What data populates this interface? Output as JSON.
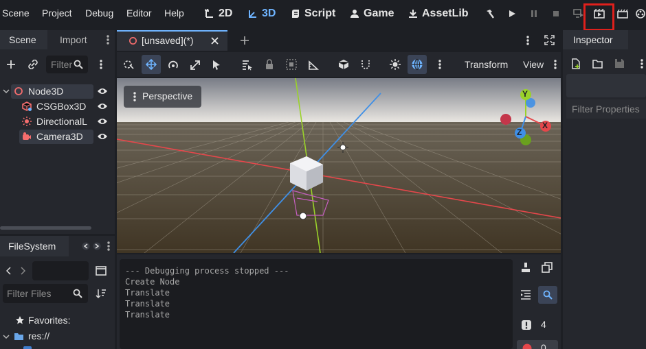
{
  "menu": {
    "items": [
      "Scene",
      "Project",
      "Debug",
      "Editor",
      "Help"
    ],
    "workspaces": [
      {
        "label": "2D",
        "icon": "2d-workspace-icon",
        "active": false
      },
      {
        "label": "3D",
        "icon": "3d-workspace-icon",
        "active": true
      },
      {
        "label": "Script",
        "icon": "script-icon",
        "active": false
      },
      {
        "label": "Game",
        "icon": "game-icon",
        "active": false
      },
      {
        "label": "AssetLib",
        "icon": "assetlib-icon",
        "active": false
      }
    ]
  },
  "scene_dock": {
    "tabs": [
      "Scene",
      "Import"
    ],
    "filter_placeholder": "Filter",
    "nodes": [
      {
        "label": "Node3D",
        "icon": "node3d-icon"
      },
      {
        "label": "CSGBox3D",
        "icon": "csgbox-icon"
      },
      {
        "label": "DirectionalL",
        "icon": "directional-light-icon"
      },
      {
        "label": "Camera3D",
        "icon": "camera-icon"
      }
    ]
  },
  "filesystem_dock": {
    "title": "FileSystem",
    "filter_placeholder": "Filter Files",
    "favorites_label": "Favorites:",
    "root_label": "res://"
  },
  "editor": {
    "tab_label": "[unsaved](*)",
    "transform_menu": "Transform",
    "view_menu": "View",
    "perspective_label": "Perspective",
    "gizmo_axes": {
      "x": "X",
      "y": "Y",
      "z": "Z"
    }
  },
  "output": {
    "lines": [
      "--- Debugging process stopped ---",
      "Create Node",
      "Translate",
      "Translate",
      "Translate"
    ],
    "warning_count": "4",
    "error_count": "0"
  },
  "inspector": {
    "title": "Inspector",
    "filter_placeholder": "Filter Properties"
  },
  "colors": {
    "accent": "#6fb4ff",
    "highlight_box": "#e0201c",
    "x_axis": "#e5474b",
    "y_axis": "#9ad22a",
    "z_axis": "#3f8fe6"
  }
}
